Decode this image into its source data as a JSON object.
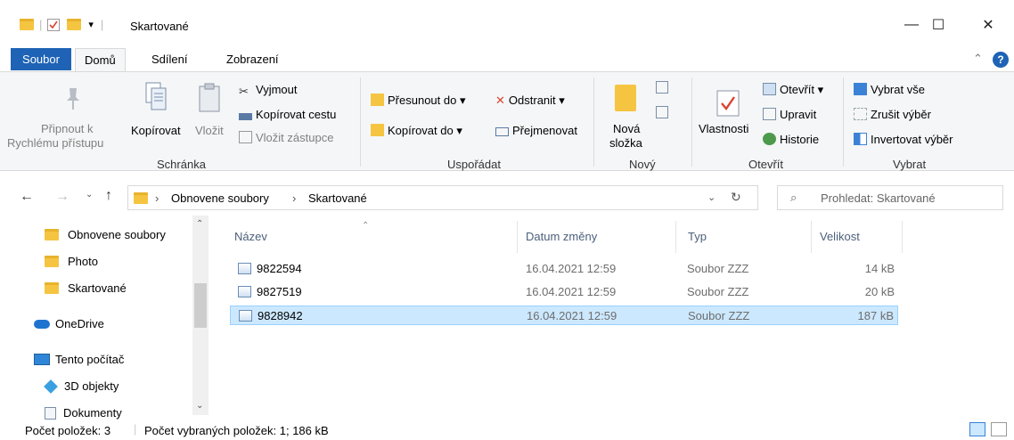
{
  "window": {
    "title": "Skartované",
    "minimize_glyph": "—",
    "maximize_glyph": "☐",
    "close_glyph": "✕"
  },
  "ribbon_tabs": {
    "file": "Soubor",
    "home": "Domů",
    "share": "Sdílení",
    "view": "Zobrazení",
    "help": "?"
  },
  "ribbon": {
    "clipboard": {
      "label": "Schránka",
      "pin_line1": "Připnout k",
      "pin_line2": "Rychlému přístupu",
      "copy": "Kopírovat",
      "paste": "Vložit",
      "cut": "Vyjmout",
      "copy_path": "Kopírovat cestu",
      "paste_shortcut": "Vložit zástupce"
    },
    "organize": {
      "label": "Uspořádat",
      "move_to": "Přesunout do ▾",
      "copy_to": "Kopírovat do ▾",
      "delete": "Odstranit ▾",
      "rename": "Přejmenovat"
    },
    "new": {
      "label": "Nový",
      "new_folder_line1": "Nová",
      "new_folder_line2": "složka"
    },
    "open": {
      "label": "Otevřít",
      "properties": "Vlastnosti",
      "open": "Otevřít ▾",
      "edit": "Upravit",
      "history": "Historie"
    },
    "select": {
      "label": "Vybrat",
      "select_all": "Vybrat vše",
      "select_none": "Zrušit výběr",
      "invert": "Invertovat výběr"
    }
  },
  "address": {
    "crumbs": [
      "Obnovene soubory",
      "Skartované"
    ],
    "search_placeholder": "Prohledat: Skartované"
  },
  "nav_pane": [
    {
      "label": "Obnovene soubory",
      "icon": "folder-icon"
    },
    {
      "label": "Photo",
      "icon": "folder-icon"
    },
    {
      "label": "Skartované",
      "icon": "folder-icon"
    },
    {
      "label": "OneDrive",
      "icon": "cloud-icon"
    },
    {
      "label": "Tento počítač",
      "icon": "computer-icon"
    },
    {
      "label": "3D objekty",
      "icon": "cube-icon"
    },
    {
      "label": "Dokumenty",
      "icon": "documents-icon"
    }
  ],
  "columns": [
    "Název",
    "Datum změny",
    "Typ",
    "Velikost"
  ],
  "files": [
    {
      "name": "9822594",
      "date": "16.04.2021 12:59",
      "type": "Soubor ZZZ",
      "size": "14 kB",
      "selected": false
    },
    {
      "name": "9827519",
      "date": "16.04.2021 12:59",
      "type": "Soubor ZZZ",
      "size": "20 kB",
      "selected": false
    },
    {
      "name": "9828942",
      "date": "16.04.2021 12:59",
      "type": "Soubor ZZZ",
      "size": "187 kB",
      "selected": true
    }
  ],
  "status": {
    "count": "Počet položek: 3",
    "selected": "Počet vybraných položek: 1; 186 kB"
  },
  "colors": {
    "accent": "#1e63b5",
    "selection": "#cce8ff",
    "folder": "#f5c542"
  }
}
